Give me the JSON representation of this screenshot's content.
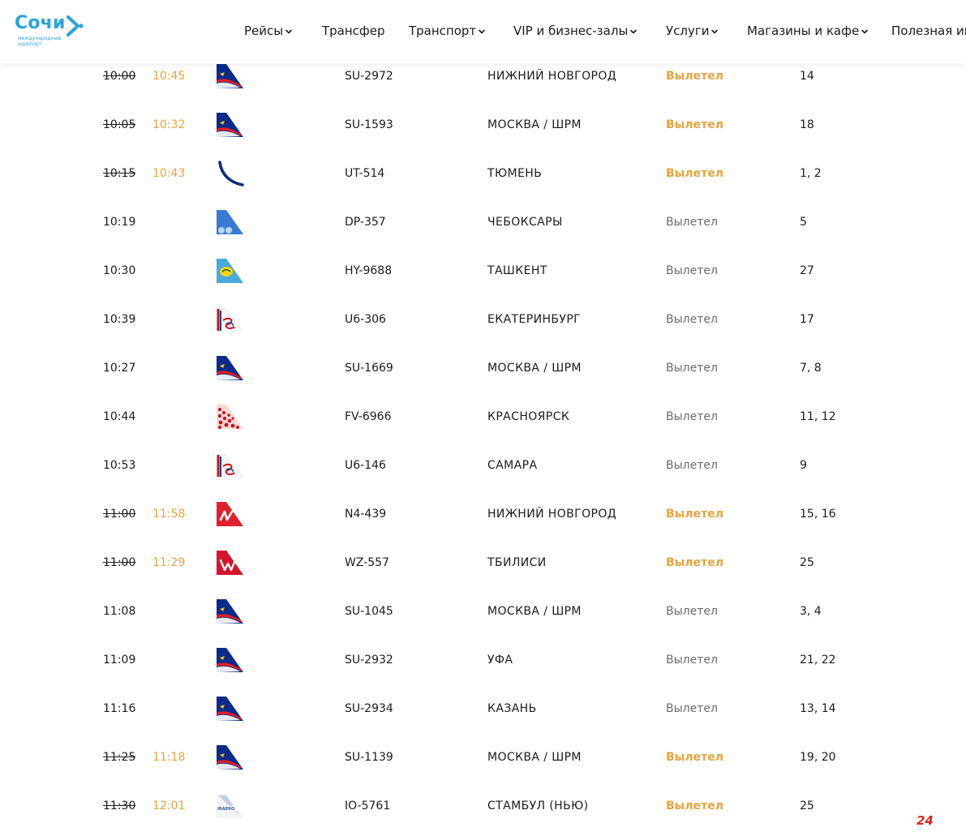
{
  "header": {
    "logo_name": "Сочи",
    "logo_sub": "международный аэропорт",
    "nav": [
      {
        "label": "Рейсы",
        "dropdown": true
      },
      {
        "label": "Трансфер",
        "dropdown": false
      },
      {
        "label": "Транспорт",
        "dropdown": true
      },
      {
        "label": "VIP и бизнес-залы",
        "dropdown": true
      },
      {
        "label": "Услуги",
        "dropdown": true
      },
      {
        "label": "Магазины и кафе",
        "dropdown": true
      },
      {
        "label": "Полезная ин",
        "dropdown": false
      }
    ]
  },
  "colors": {
    "accent": "#e8a33d",
    "brand": "#2aa4d8",
    "text": "#1b1b1b",
    "muted": "#6a6a6a"
  },
  "flights": [
    {
      "scheduled": "10:00",
      "actual": "10:45",
      "airline_icon": "aeroflot-tail-icon",
      "flight": "SU-2972",
      "city": "НИЖНИЙ НОВГОРОД",
      "status": "Вылетел",
      "delayed": true,
      "gate": "14"
    },
    {
      "scheduled": "10:05",
      "actual": "10:32",
      "airline_icon": "aeroflot-tail-icon",
      "flight": "SU-1593",
      "city": "МОСКВА / ШРМ",
      "status": "Вылетел",
      "delayed": true,
      "gate": "18"
    },
    {
      "scheduled": "10:15",
      "actual": "10:43",
      "airline_icon": "utair-tail-icon",
      "flight": "UT-514",
      "city": "ТЮМЕНЬ",
      "status": "Вылетел",
      "delayed": true,
      "gate": "1, 2"
    },
    {
      "scheduled": "10:19",
      "actual": "",
      "airline_icon": "pobeda-tail-icon",
      "flight": "DP-357",
      "city": "ЧЕБОКСАРЫ",
      "status": "Вылетел",
      "delayed": false,
      "gate": "5"
    },
    {
      "scheduled": "10:30",
      "actual": "",
      "airline_icon": "uzbekistan-tail-icon",
      "flight": "HY-9688",
      "city": "ТАШКЕНТ",
      "status": "Вылетел",
      "delayed": false,
      "gate": "27"
    },
    {
      "scheduled": "10:39",
      "actual": "",
      "airline_icon": "ural-airlines-tail-icon",
      "flight": "U6-306",
      "city": "ЕКАТЕРИНБУРГ",
      "status": "Вылетел",
      "delayed": false,
      "gate": "17"
    },
    {
      "scheduled": "10:27",
      "actual": "",
      "airline_icon": "aeroflot-tail-icon",
      "flight": "SU-1669",
      "city": "МОСКВА / ШРМ",
      "status": "Вылетел",
      "delayed": false,
      "gate": "7, 8"
    },
    {
      "scheduled": "10:44",
      "actual": "",
      "airline_icon": "rossiya-tail-icon",
      "flight": "FV-6966",
      "city": "КРАСНОЯРСК",
      "status": "Вылетел",
      "delayed": false,
      "gate": "11, 12"
    },
    {
      "scheduled": "10:53",
      "actual": "",
      "airline_icon": "ural-airlines-tail-icon",
      "flight": "U6-146",
      "city": "САМАРА",
      "status": "Вылетел",
      "delayed": false,
      "gate": "9"
    },
    {
      "scheduled": "11:00",
      "actual": "11:58",
      "airline_icon": "nordwind-tail-icon",
      "flight": "N4-439",
      "city": "НИЖНИЙ НОВГОРОД",
      "status": "Вылетел",
      "delayed": true,
      "gate": "15, 16"
    },
    {
      "scheduled": "11:00",
      "actual": "11:29",
      "airline_icon": "red-wings-tail-icon",
      "flight": "WZ-557",
      "city": "ТБИЛИСИ",
      "status": "Вылетел",
      "delayed": true,
      "gate": "25"
    },
    {
      "scheduled": "11:08",
      "actual": "",
      "airline_icon": "aeroflot-tail-icon",
      "flight": "SU-1045",
      "city": "МОСКВА / ШРМ",
      "status": "Вылетел",
      "delayed": false,
      "gate": "3, 4"
    },
    {
      "scheduled": "11:09",
      "actual": "",
      "airline_icon": "aeroflot-tail-icon",
      "flight": "SU-2932",
      "city": "УФА",
      "status": "Вылетел",
      "delayed": false,
      "gate": "21, 22"
    },
    {
      "scheduled": "11:16",
      "actual": "",
      "airline_icon": "aeroflot-tail-icon",
      "flight": "SU-2934",
      "city": "КАЗАНЬ",
      "status": "Вылетел",
      "delayed": false,
      "gate": "13, 14"
    },
    {
      "scheduled": "11:25",
      "actual": "11:18",
      "airline_icon": "aeroflot-tail-icon",
      "flight": "SU-1139",
      "city": "МОСКВА / ШРМ",
      "status": "Вылетел",
      "delayed": true,
      "gate": "19, 20"
    },
    {
      "scheduled": "11:30",
      "actual": "12:01",
      "airline_icon": "iraero-tail-icon",
      "flight": "IO-5761",
      "city": "СТАМБУЛ (НЬЮ)",
      "status": "Вылетел",
      "delayed": true,
      "gate": "25"
    }
  ],
  "watermark": "24"
}
